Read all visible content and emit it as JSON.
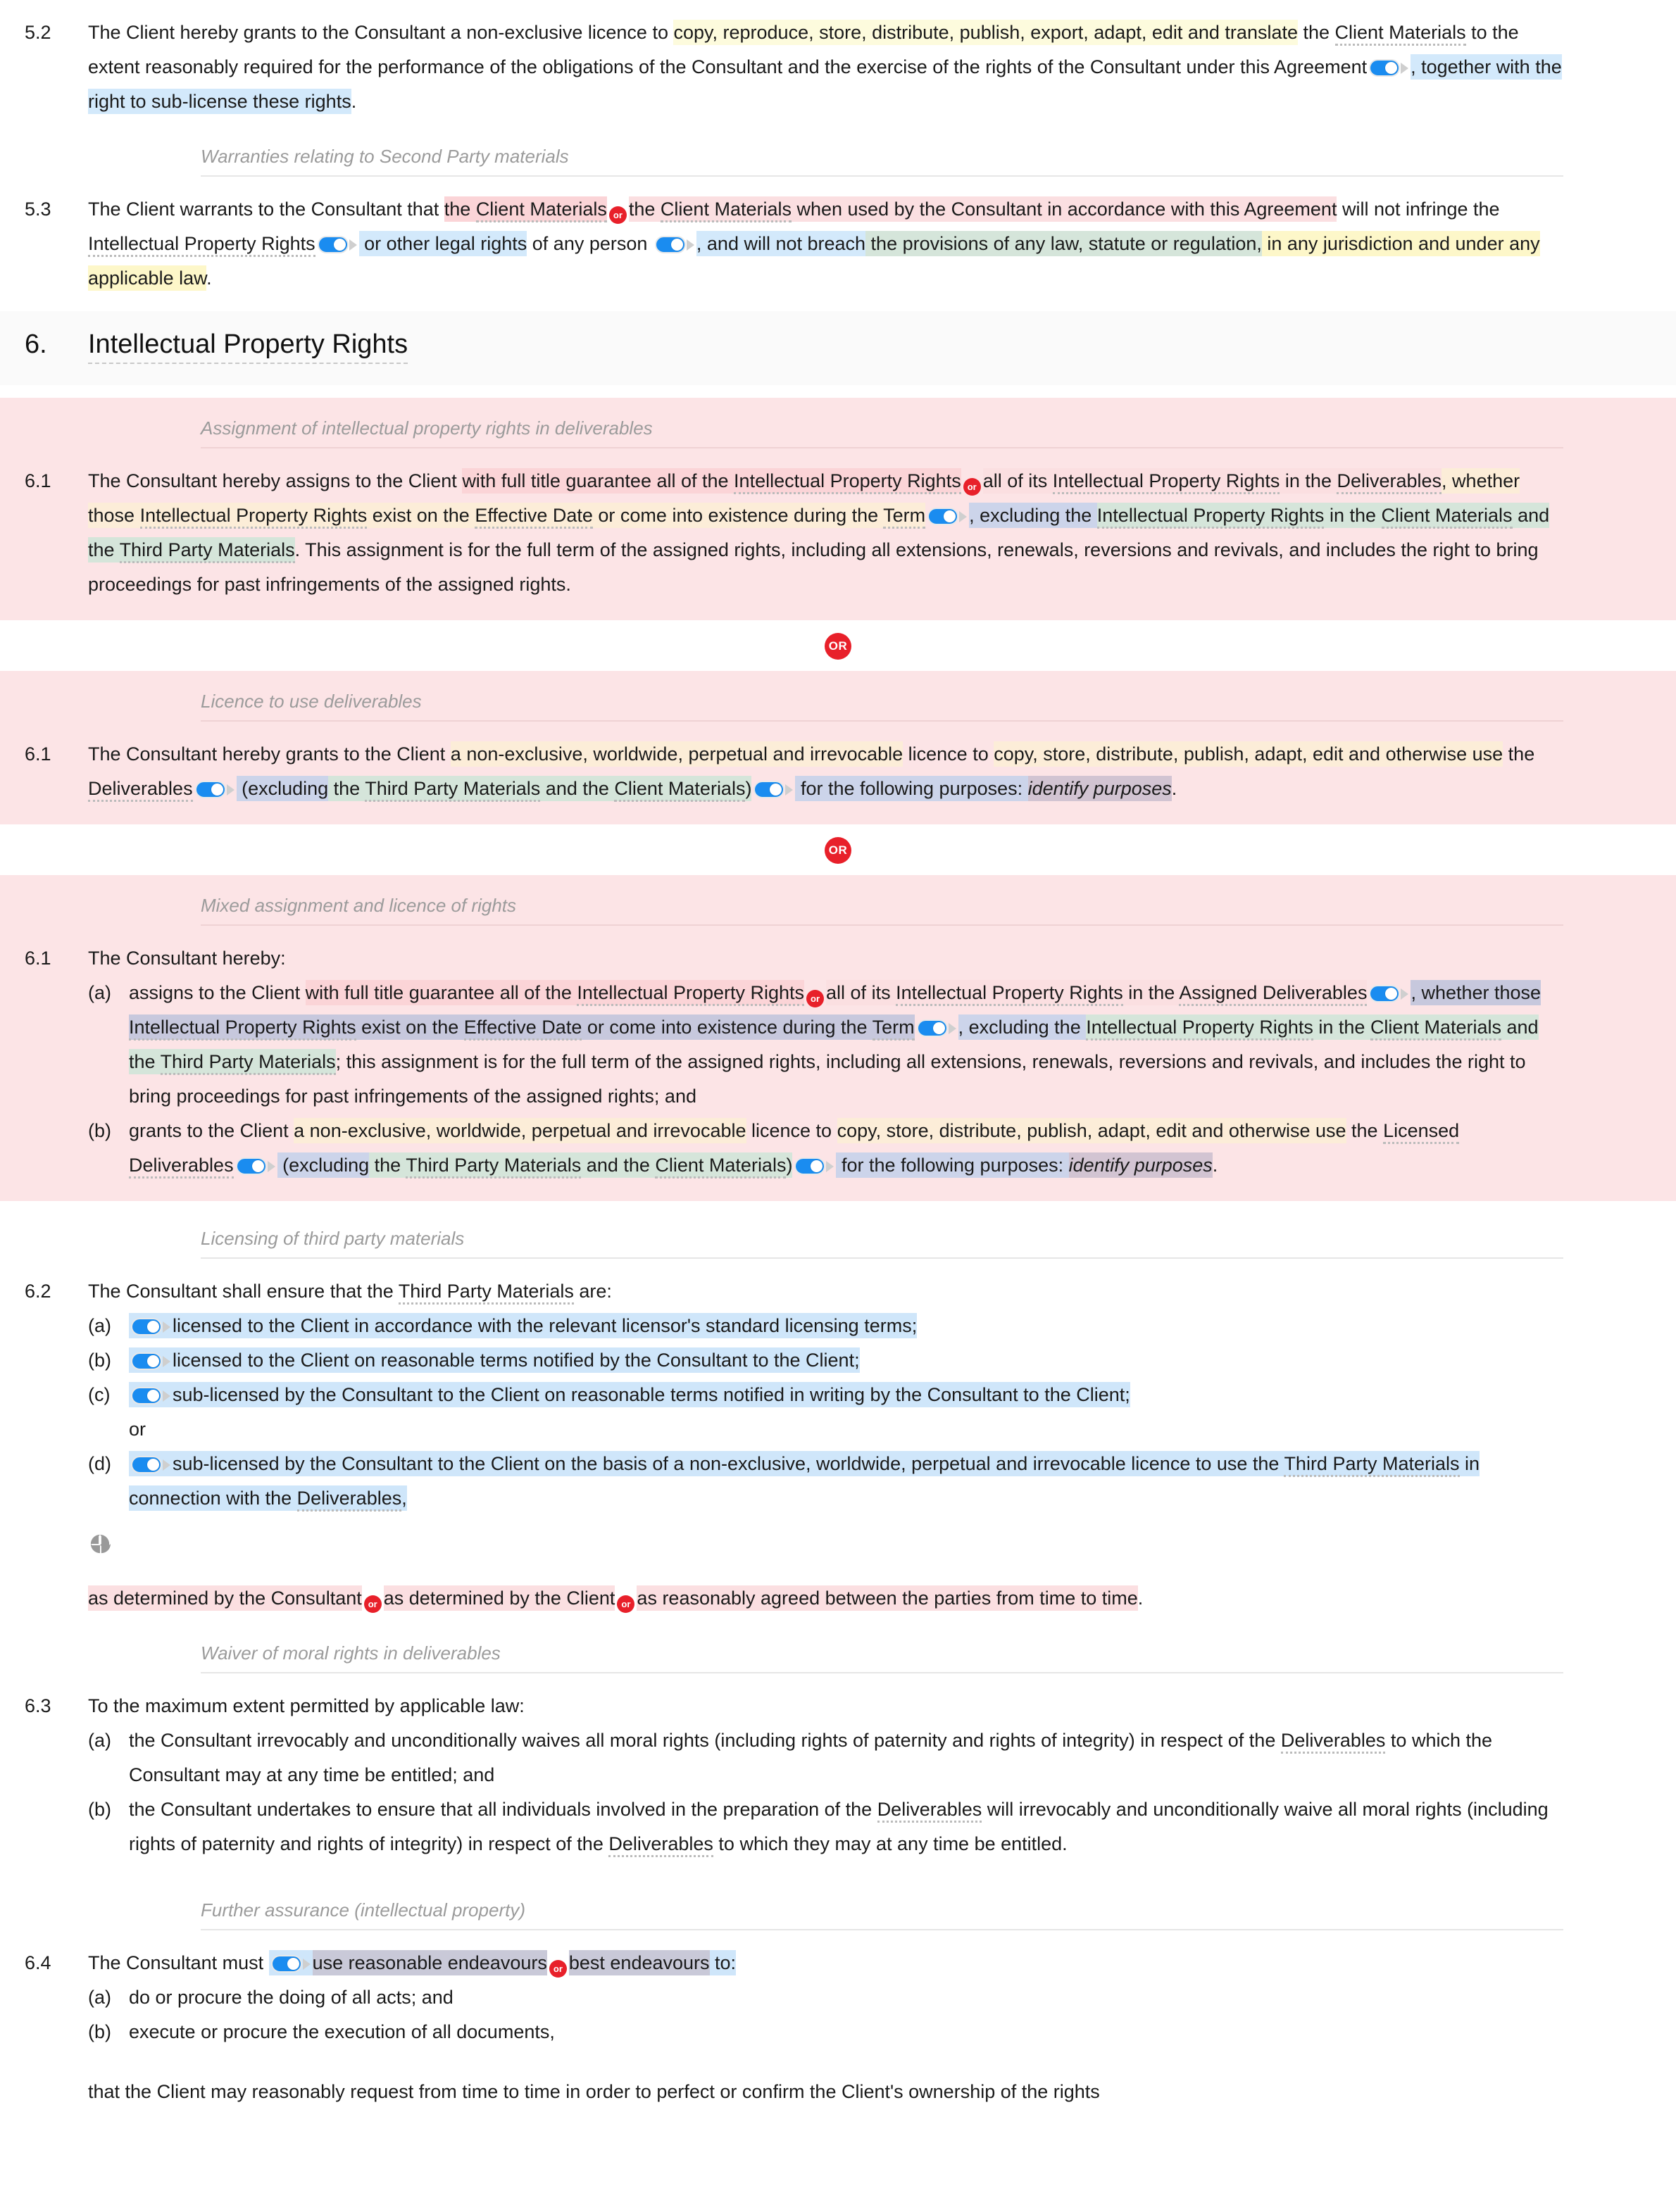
{
  "colors": {
    "accent_blue": "#1a8cf0",
    "or_red": "#e8202a",
    "alt_block_pink": "#fce4e6",
    "section_head_gray": "#fafafa",
    "subhead_gray": "#9b9b9b"
  },
  "icons": {
    "toggle": "toggle-switch-on",
    "or_badge": "or-badge",
    "move": "move-crosshair"
  },
  "clause_5_2": {
    "number": "5.2",
    "t1": "The Client hereby grants to the Consultant a non-exclusive licence to ",
    "h1": "copy, reproduce, store, distribute, publish, export, adapt, edit and translate",
    "t2": " the ",
    "term1": "Client Materials",
    "t3": " to the extent reasonably required for the performance of the obligations of the Consultant and the exercise of the rights of the Consultant under this Agreement",
    "h2": ", together with the right to sub-license these rights",
    "t4": "."
  },
  "subhead_warranties": "Warranties relating to Second Party materials",
  "clause_5_3": {
    "number": "5.3",
    "t1": "The Client warrants to the Consultant that ",
    "h1": "the ",
    "term1": "Client Materials",
    "or1": "or",
    "h2": "the ",
    "term2": "Client Materials",
    "h2b": " when used by the Consultant in accordance with this Agreement",
    "t2": " will not infringe the ",
    "term3": "Intellectual Property Rights",
    "h3": " or other legal rights",
    "t3": " of any person ",
    "h4": ", and will not breach",
    "h5": " the provisions of any law, statute or regulation,",
    "h6": " in any jurisdiction and under any applicable law",
    "t4": "."
  },
  "section_6": {
    "number": "6.",
    "title": "Intellectual Property Rights"
  },
  "alt_1": {
    "subhead": "Assignment of intellectual property rights in deliverables",
    "number": "6.1",
    "t1": "The Consultant hereby assigns to the Client ",
    "h1": "with full title guarantee all of the ",
    "h1term": "Intellectual Property Rights",
    "or1": "or",
    "h2": "all of its ",
    "h2term": "Intellectual Property Rights",
    "h2b": " in the ",
    "h2term2": "Deliverables",
    "h3": ", whether those ",
    "h3term": "Intellectual Property Rights",
    "h3b": " exist on the ",
    "h3term2": "Effective Date",
    "h3c": " or come into existence during the ",
    "h3term3": "Term",
    "h4": ", excluding the ",
    "h4term": "Intellectual Property Rights",
    "h4b": " in the ",
    "h4term2": "Client Materials",
    "h4c": " and the ",
    "h4term3": "Third Party Materials",
    "t2": ". This assignment is for the full term of the assigned rights, including all extensions, renewals, reversions and revivals, and includes the right to bring proceedings for past infringements of the assigned rights."
  },
  "alt_2": {
    "subhead": "Licence to use deliverables",
    "number": "6.1",
    "t1": "The Consultant hereby grants to the Client ",
    "h1": "a non-exclusive, worldwide, perpetual and irrevocable",
    "t2": " licence to ",
    "h2": "copy, store, distribute, publish, adapt, edit and otherwise use",
    "t3": " the ",
    "term1": "Deliverables",
    "h3": " (excluding",
    "h4": " the ",
    "h4term": "Third Party Materials",
    "h4b": " and the ",
    "h4term2": "Client Materials",
    "h5": ")",
    "h6": " for the following purposes: ",
    "h6it": "identify purposes",
    "t4": "."
  },
  "alt_3": {
    "subhead": "Mixed assignment and licence of rights",
    "number": "6.1",
    "lead": "The Consultant hereby:",
    "a_label": "(a)",
    "a_t1": "assigns to the Client ",
    "a_h1": "with full title guarantee all of the ",
    "a_h1term": "Intellectual Property Rights",
    "a_or": "or",
    "a_h2": "all of its ",
    "a_h2term": "Intellectual Property Rights",
    "a_t2": " in the ",
    "a_term2": "Assigned Deliverables",
    "a_h3": ", whether those ",
    "a_h3term": "Intellectual Property Rights",
    "a_h3b": " exist on the ",
    "a_h3term2": "Effective Date",
    "a_h3c": " or come into existence during the ",
    "a_h3term3": "Term",
    "a_h4": ", excluding the ",
    "a_h4term": "Intellectual Property Rights",
    "a_h4b": " in the ",
    "a_h4term2": "Client Materials",
    "a_h4c": " and the ",
    "a_h4term3": "Third Party Materials",
    "a_t3": "; this assignment is for the full term of the assigned rights, including all extensions, renewals, reversions and revivals, and includes the right to bring proceedings for past infringements of the assigned rights; and",
    "b_label": "(b)",
    "b_t1": "grants to the Client ",
    "b_h1": "a non-exclusive, worldwide, perpetual and irrevocable",
    "b_t2": " licence to ",
    "b_h2": "copy, store, distribute, publish, adapt, edit and otherwise use",
    "b_t3": " the ",
    "b_term1": "Licensed Deliverables",
    "b_h3": " (excluding",
    "b_h4": " the ",
    "b_h4term": "Third Party Materials",
    "b_h4b": " and the ",
    "b_h4term2": "Client Materials",
    "b_h5": ")",
    "b_h6": " for the following purposes: ",
    "b_h6it": "identify purposes",
    "b_t4": "."
  },
  "sec_6_2": {
    "subhead": "Licensing of third party materials",
    "number": "6.2",
    "lead_t1": "The Consultant shall ensure that the ",
    "lead_term": "Third Party Materials",
    "lead_t2": " are:",
    "items": [
      {
        "label": "(a)",
        "text": "licensed to the Client in accordance with the relevant licensor's standard licensing terms;"
      },
      {
        "label": "(b)",
        "text": "licensed to the Client on reasonable terms notified by the Consultant to the Client;"
      },
      {
        "label": "(c)",
        "text": "sub-licensed by the Consultant to the Client on reasonable terms notified in writing by the Consultant to the Client;"
      }
    ],
    "or_word": "or",
    "item_d_label": "(d)",
    "item_d_t1": "sub-licensed by the Consultant to the Client on the basis of a non-exclusive, worldwide, perpetual and irrevocable licence to use the ",
    "item_d_term": "Third Party Materials",
    "item_d_t2": " in connection with the ",
    "item_d_term2": "Deliverables",
    "item_d_t3": ",",
    "tail_h1": "as determined by the Consultant",
    "tail_or1": "or",
    "tail_h2": "as determined by the Client",
    "tail_or2": "or",
    "tail_h3": "as reasonably agreed between the parties from time to time",
    "tail_t": "."
  },
  "sec_6_3": {
    "subhead": "Waiver of moral rights in deliverables",
    "number": "6.3",
    "lead": "To the maximum extent permitted by applicable law:",
    "a_label": "(a)",
    "a_t1": "the Consultant irrevocably and unconditionally waives all moral rights (including rights of paternity and rights of integrity) in respect of the ",
    "a_term": "Deliverables",
    "a_t2": " to which the Consultant may at any time be entitled; and",
    "b_label": "(b)",
    "b_t1": "the Consultant undertakes to ensure that all individuals involved in the preparation of the ",
    "b_term": "Deliverables",
    "b_t2": " will irrevocably and unconditionally waive all moral rights (including rights of paternity and rights of integrity) in respect of the ",
    "b_term2": "Deliverables",
    "b_t3": " to which they may at any time be entitled."
  },
  "sec_6_4": {
    "subhead": "Further assurance (intellectual property)",
    "number": "6.4",
    "t1": "The Consultant must ",
    "h1": "use reasonable endeavours",
    "or1": "or",
    "h2": "best endeavours",
    "h3": " to:",
    "a_label": "(a)",
    "a_text": "do or procure the doing of all acts; and",
    "b_label": "(b)",
    "b_text": "execute or procure the execution of all documents,",
    "tail": "that the Client may reasonably request from time to time in order to perfect or confirm the Client's ownership of the rights"
  }
}
